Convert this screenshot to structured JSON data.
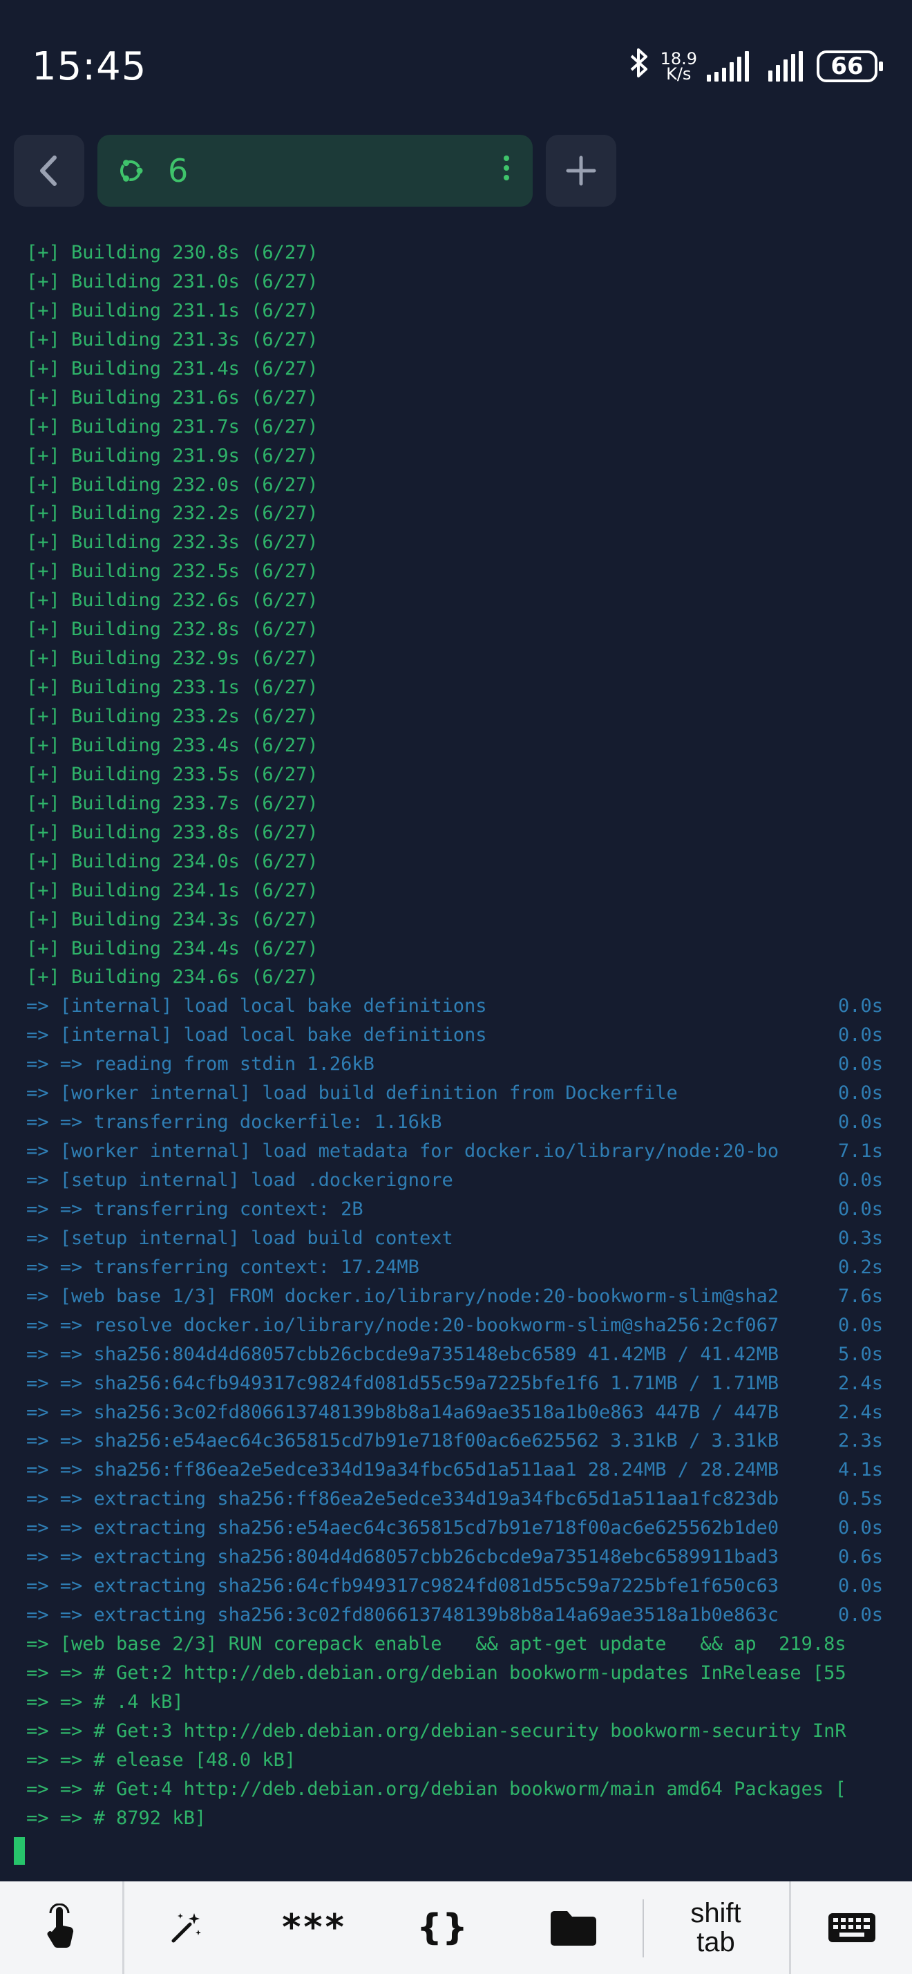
{
  "status_bar": {
    "time": "15:45",
    "network_speed_value": "18.9",
    "network_speed_unit": "K/s",
    "battery_level": "66",
    "icons": [
      "bluetooth-icon",
      "cell-signal-1-icon",
      "cell-signal-2-icon",
      "battery-icon"
    ]
  },
  "tab_bar": {
    "back_icon": "chevron-left-icon",
    "session_icon": "ubuntu-icon",
    "session_label": "6",
    "session_menu_icon": "vertical-dots-icon",
    "add_icon": "plus-icon"
  },
  "terminal": {
    "colors": {
      "green": "#2fb46a",
      "blue": "#2f7eb4",
      "background": "#151c2f"
    },
    "building_lines": [
      "[+] Building 230.8s (6/27)",
      "[+] Building 231.0s (6/27)",
      "[+] Building 231.1s (6/27)",
      "[+] Building 231.3s (6/27)",
      "[+] Building 231.4s (6/27)",
      "[+] Building 231.6s (6/27)",
      "[+] Building 231.7s (6/27)",
      "[+] Building 231.9s (6/27)",
      "[+] Building 232.0s (6/27)",
      "[+] Building 232.2s (6/27)",
      "[+] Building 232.3s (6/27)",
      "[+] Building 232.5s (6/27)",
      "[+] Building 232.6s (6/27)",
      "[+] Building 232.8s (6/27)",
      "[+] Building 232.9s (6/27)",
      "[+] Building 233.1s (6/27)",
      "[+] Building 233.2s (6/27)",
      "[+] Building 233.4s (6/27)",
      "[+] Building 233.5s (6/27)",
      "[+] Building 233.7s (6/27)",
      "[+] Building 233.8s (6/27)",
      "[+] Building 234.0s (6/27)",
      "[+] Building 234.1s (6/27)",
      "[+] Building 234.3s (6/27)",
      "[+] Building 234.4s (6/27)",
      "[+] Building 234.6s (6/27)"
    ],
    "step_lines": [
      {
        "text": "=> [internal] load local bake definitions",
        "time": "0.0s"
      },
      {
        "text": "=> [internal] load local bake definitions",
        "time": "0.0s"
      },
      {
        "text": "=> => reading from stdin 1.26kB",
        "time": "0.0s"
      },
      {
        "text": "=> [worker internal] load build definition from Dockerfile",
        "time": "0.0s"
      },
      {
        "text": "=> => transferring dockerfile: 1.16kB",
        "time": "0.0s"
      },
      {
        "text": "=> [worker internal] load metadata for docker.io/library/node:20-bo",
        "time": "7.1s"
      },
      {
        "text": "=> [setup internal] load .dockerignore",
        "time": "0.0s"
      },
      {
        "text": "=> => transferring context: 2B",
        "time": "0.0s"
      },
      {
        "text": "=> [setup internal] load build context",
        "time": "0.3s"
      },
      {
        "text": "=> => transferring context: 17.24MB",
        "time": "0.2s"
      },
      {
        "text": "=> [web base 1/3] FROM docker.io/library/node:20-bookworm-slim@sha2",
        "time": "7.6s"
      },
      {
        "text": "=> => resolve docker.io/library/node:20-bookworm-slim@sha256:2cf067",
        "time": "0.0s"
      },
      {
        "text": "=> => sha256:804d4d68057cbb26cbcde9a735148ebc6589 41.42MB / 41.42MB",
        "time": "5.0s"
      },
      {
        "text": "=> => sha256:64cfb949317c9824fd081d55c59a7225bfe1f6 1.71MB / 1.71MB",
        "time": "2.4s"
      },
      {
        "text": "=> => sha256:3c02fd806613748139b8b8a14a69ae3518a1b0e863 447B / 447B",
        "time": "2.4s"
      },
      {
        "text": "=> => sha256:e54aec64c365815cd7b91e718f00ac6e625562 3.31kB / 3.31kB",
        "time": "2.3s"
      },
      {
        "text": "=> => sha256:ff86ea2e5edce334d19a34fbc65d1a511aa1 28.24MB / 28.24MB",
        "time": "4.1s"
      },
      {
        "text": "=> => extracting sha256:ff86ea2e5edce334d19a34fbc65d1a511aa1fc823db",
        "time": "0.5s"
      },
      {
        "text": "=> => extracting sha256:e54aec64c365815cd7b91e718f00ac6e625562b1de0",
        "time": "0.0s"
      },
      {
        "text": "=> => extracting sha256:804d4d68057cbb26cbcde9a735148ebc6589911bad3",
        "time": "0.6s"
      },
      {
        "text": "=> => extracting sha256:64cfb949317c9824fd081d55c59a7225bfe1f650c63",
        "time": "0.0s"
      },
      {
        "text": "=> => extracting sha256:3c02fd806613748139b8b8a14a69ae3518a1b0e863c",
        "time": "0.0s"
      }
    ],
    "run_lines": [
      "=> [web base 2/3] RUN corepack enable   && apt-get update   && ap  219.8s",
      "=> => # Get:2 http://deb.debian.org/debian bookworm-updates InRelease [55",
      "=> => # .4 kB]",
      "=> => # Get:3 http://deb.debian.org/debian-security bookworm-security InR",
      "=> => # elease [48.0 kB]",
      "=> => # Get:4 http://deb.debian.org/debian bookworm/main amd64 Packages [",
      "=> => # 8792 kB]"
    ]
  },
  "extra_keys": {
    "touch_icon": "touch-hand-icon",
    "magic_icon": "magic-wand-icon",
    "password_label": "***",
    "braces_label": "{}",
    "folder_icon": "folder-icon",
    "shift_label": "shift",
    "tab_label": "tab",
    "keyboard_icon": "keyboard-icon"
  }
}
